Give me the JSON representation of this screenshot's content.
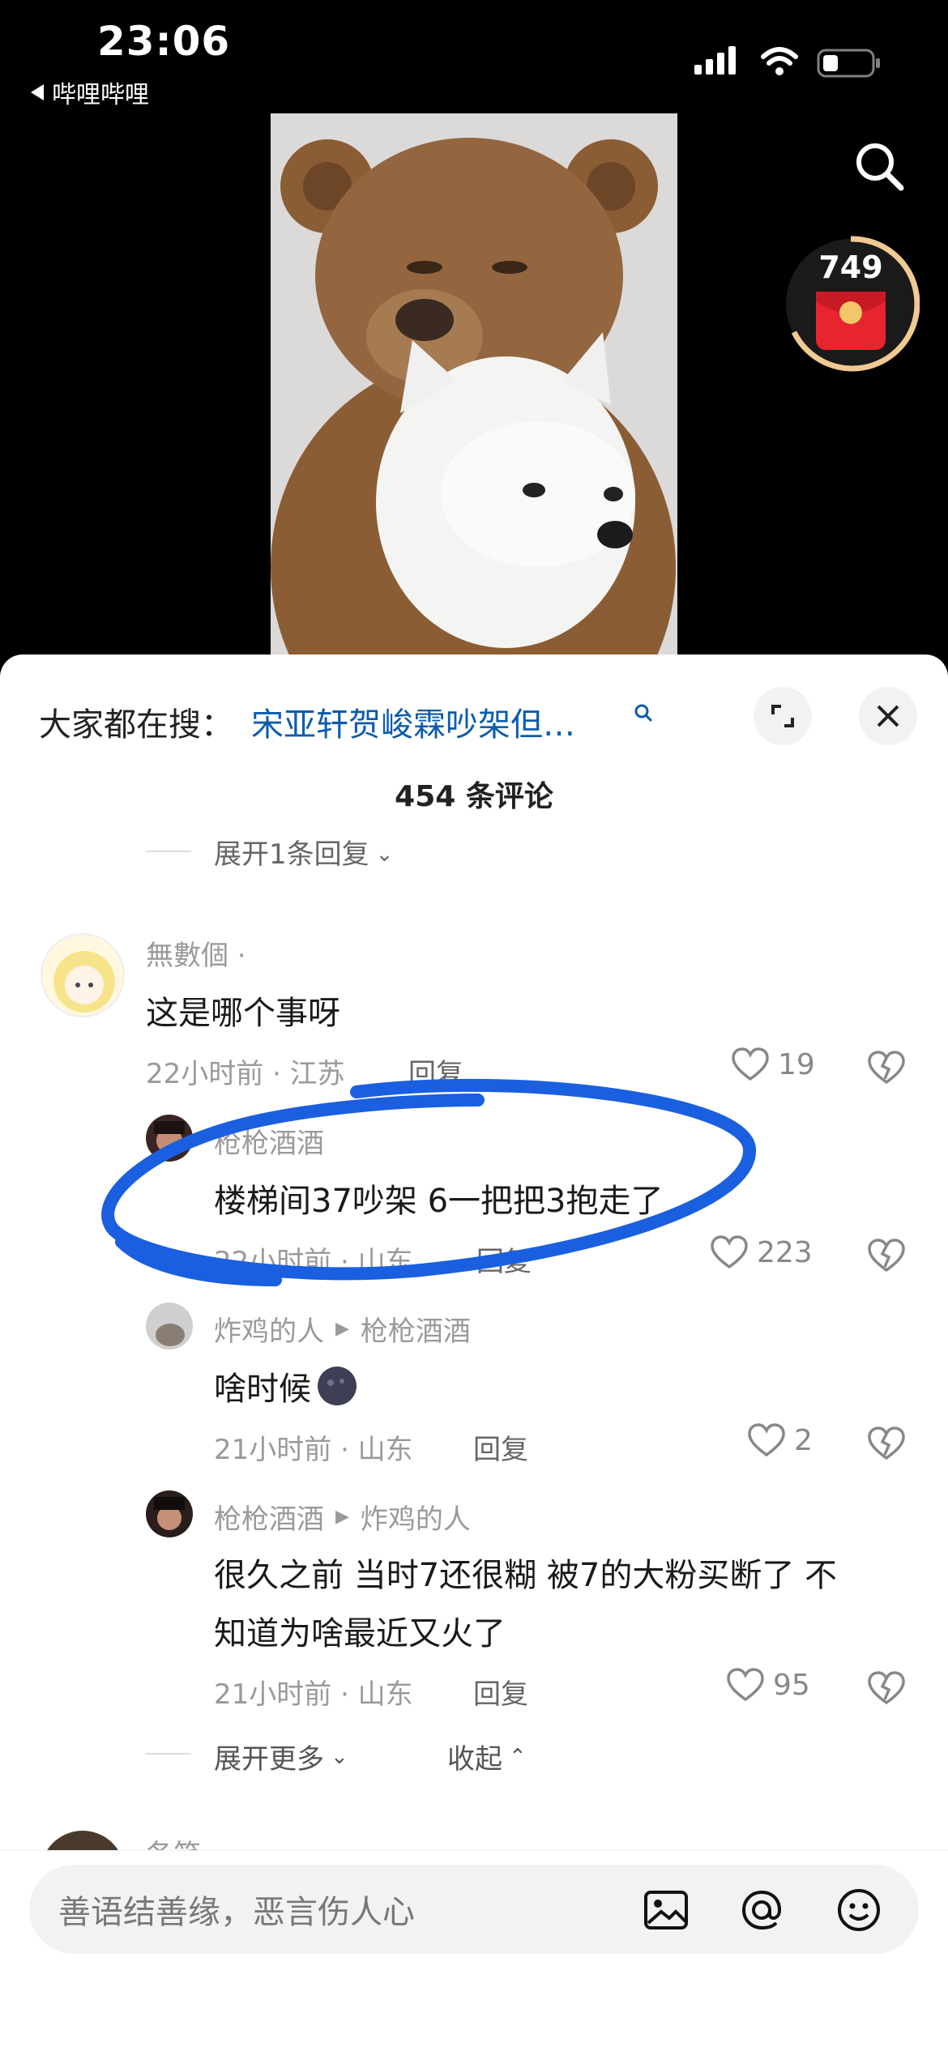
{
  "status_bar": {
    "time": "23:06",
    "back_app": "哔哩哔哩"
  },
  "video": {
    "red_packet_count": "749"
  },
  "sheet": {
    "trending_label": "大家都在搜：",
    "trending_query": "宋亚轩贺峻霖吵架但…",
    "comment_count": "454 条评论",
    "expand_prev": "展开1条回复",
    "comments": [
      {
        "name": "無數個 ·",
        "text": "这是哪个事呀",
        "meta": "22小时前 · 江苏",
        "reply": "回复",
        "likes": "19"
      },
      {
        "name": "枪枪酒酒",
        "text": "楼梯间37吵架 6一把把3抱走了",
        "meta": "22小时前 · 山东",
        "reply": "回复",
        "likes": "223"
      },
      {
        "name": "炸鸡的人",
        "reply_to": "枪枪酒酒",
        "text": "啥时候",
        "meta": "21小时前 · 山东",
        "reply": "回复",
        "likes": "2"
      },
      {
        "name": "枪枪酒酒",
        "reply_to": "炸鸡的人",
        "text_line1": "很久之前 当时7还很糊 被7的大粉买断了 不",
        "text_line2": "知道为啥最近又火了",
        "meta": "21小时前 · 山东",
        "reply": "回复",
        "likes": "95"
      }
    ],
    "expand_more": "展开更多",
    "collapse": "收起",
    "next_name": "各笑"
  },
  "input": {
    "placeholder": "善语结善缘，恶言伤人心"
  },
  "colors": {
    "link": "#0b5cad",
    "annotation": "#1a5fe0",
    "red_packet": "#e8242f"
  }
}
